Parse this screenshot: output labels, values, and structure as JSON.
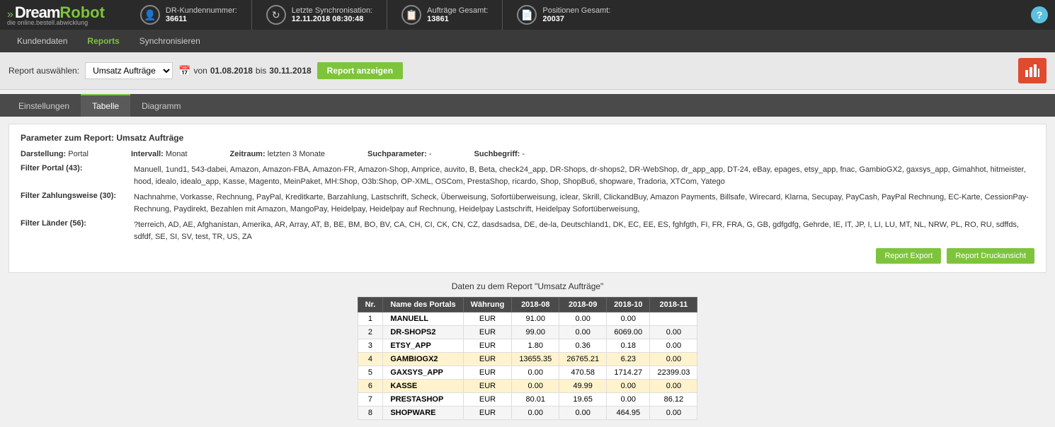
{
  "header": {
    "logo": {
      "arrows": "»",
      "dream": "Dream",
      "robot": "Robot",
      "subtitle": "die online.bestell.abwicklung"
    },
    "kundennummer_label": "DR-Kundennummer:",
    "kundennummer_value": "36611",
    "sync_label": "Letzte Synchronisation:",
    "sync_value": "12.11.2018 08:30:48",
    "auftraege_label": "Aufträge Gesamt:",
    "auftraege_value": "13861",
    "positionen_label": "Positionen Gesamt:",
    "positionen_value": "20037",
    "help": "?"
  },
  "nav": {
    "items": [
      {
        "label": "Kundendaten",
        "active": false
      },
      {
        "label": "Reports",
        "active": true
      },
      {
        "label": "Synchronisieren",
        "active": false
      }
    ]
  },
  "toolbar": {
    "report_select_label": "Report auswählen:",
    "report_select_value": "Umsatz Aufträge",
    "date_from": "01.08.2018",
    "date_to": "30.11.2018",
    "date_separator": "bis",
    "date_von": "von",
    "btn_report": "Report anzeigen"
  },
  "tabs": [
    {
      "label": "Einstellungen",
      "active": false
    },
    {
      "label": "Tabelle",
      "active": true
    },
    {
      "label": "Diagramm",
      "active": false
    }
  ],
  "params": {
    "title": "Parameter zum Report: Umsatz Aufträge",
    "darstellung_label": "Darstellung:",
    "darstellung_value": "Portal",
    "intervall_label": "Intervall:",
    "intervall_value": "Monat",
    "zeitraum_label": "Zeitraum:",
    "zeitraum_value": "letzten 3 Monate",
    "suchparameter_label": "Suchparameter:",
    "suchparameter_value": "-",
    "suchbegriff_label": "Suchbegriff:",
    "suchbegriff_value": "-",
    "filter_portal_label": "Filter Portal (43):",
    "filter_portal_value": "Manuell, 1und1, 543-dabei, Amazon, Amazon-FBA, Amazon-FR, Amazon-Shop, Amprice, auvito, B, Beta, check24_app, DR-Shops, dr-shops2, DR-WebShop, dr_app_app, DT-24, eBay, epages, etsy_app, fnac, GambioGX2, gaxsys_app, Gimahhot, hitmeister, hood, idealo, idealo_app, Kasse, Magento, MeinPaket, MH:Shop, O3b:Shop, OP-XML, OSCom, PrestaShop, ricardo, Shop, ShopBu6, shopware, Tradoria, XTCom, Yatego",
    "filter_zahlung_label": "Filter Zahlungsweise (30):",
    "filter_zahlung_value": "Nachnahme, Vorkasse, Rechnung, PayPal, Kreditkarte, Barzahlung, Lastschrift, Scheck, Überweisung, Sofortüberweisung, iclear, Skrill, ClickandBuy, Amazon Payments, Billsafe, Wirecard, Klarna, Secupay, PayCash, PayPal Rechnung, EC-Karte, CessionPay-Rechnung, Paydirekt, Bezahlen mit Amazon, MangoPay, Heidelpay, Heidelpay auf Rechnung, Heidelpay Lastschrift, Heidelpay Sofortüberweisung,",
    "filter_laender_label": "Filter Länder (56):",
    "filter_laender_value": "?terreich, AD, AE, Afghanistan, Amerika, AR, Array, AT, B, BE, BM, BO, BV, CA, CH, CI, CK, CN, CZ, dasdsadsa, DE, de-la, Deutschland1, DK, EC, EE, ES, fghfgth, FI, FR, FRA, G, GB, gdfgdfg, Gehrde, IE, IT, JP, I, LI, LU, MT, NL, NRW, PL, RO, RU, sdffds, sdfdf, SE, SI, SV, test, TR, US, ZA",
    "btn_export": "Report Export",
    "btn_print": "Report Druckansicht"
  },
  "table": {
    "title": "Daten zu dem Report \"Umsatz Aufträge\"",
    "columns": [
      "Nr.",
      "Name des Portals",
      "Währung",
      "2018-08",
      "2018-09",
      "2018-10",
      "2018-11"
    ],
    "rows": [
      {
        "nr": "1",
        "portal": "MANUELL",
        "waehrung": "EUR",
        "m1": "91.00",
        "m2": "0.00",
        "m3": "0.00",
        "m4": ""
      },
      {
        "nr": "2",
        "portal": "DR-SHOPS2",
        "waehrung": "EUR",
        "m1": "99.00",
        "m2": "0.00",
        "m3": "6069.00",
        "m4": "0.00"
      },
      {
        "nr": "3",
        "portal": "ETSY_APP",
        "waehrung": "EUR",
        "m1": "1.80",
        "m2": "0.36",
        "m3": "0.18",
        "m4": "0.00"
      },
      {
        "nr": "4",
        "portal": "GAMBIOGX2",
        "waehrung": "EUR",
        "m1": "13655.35",
        "m2": "26765.21",
        "m3": "6.23",
        "m4": "0.00",
        "highlight": true
      },
      {
        "nr": "5",
        "portal": "GAXSYS_APP",
        "waehrung": "EUR",
        "m1": "0.00",
        "m2": "470.58",
        "m3": "1714.27",
        "m4": "22399.03"
      },
      {
        "nr": "6",
        "portal": "KASSE",
        "waehrung": "EUR",
        "m1": "0.00",
        "m2": "49.99",
        "m3": "0.00",
        "m4": "0.00",
        "highlight": true
      },
      {
        "nr": "7",
        "portal": "PRESTASHOP",
        "waehrung": "EUR",
        "m1": "80.01",
        "m2": "19.65",
        "m3": "0.00",
        "m4": "86.12"
      },
      {
        "nr": "8",
        "portal": "SHOPWARE",
        "waehrung": "EUR",
        "m1": "0.00",
        "m2": "0.00",
        "m3": "464.95",
        "m4": "0.00"
      }
    ]
  }
}
